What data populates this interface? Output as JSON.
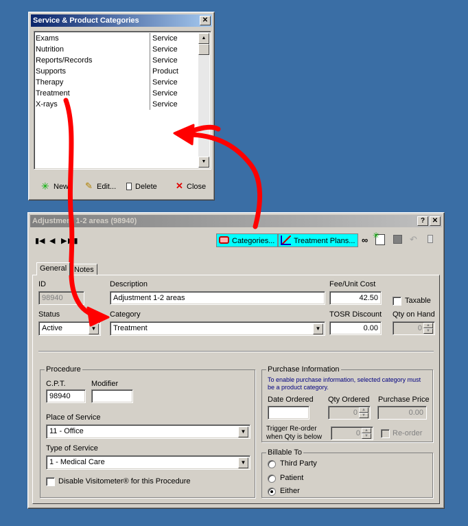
{
  "categories_window": {
    "title": "Service & Product Categories",
    "close_glyph": "✕",
    "rows": [
      {
        "name": "Exams",
        "type": "Service"
      },
      {
        "name": "Nutrition",
        "type": "Service"
      },
      {
        "name": "Reports/Records",
        "type": "Service"
      },
      {
        "name": "Supports",
        "type": "Product"
      },
      {
        "name": "Therapy",
        "type": "Service"
      },
      {
        "name": "Treatment",
        "type": "Service"
      },
      {
        "name": "X-rays",
        "type": "Service"
      }
    ],
    "buttons": {
      "new": "New",
      "edit": "Edit...",
      "delete": "Delete",
      "close": "Close"
    }
  },
  "main_window": {
    "title": "Adjustment 1-2 areas (98940)",
    "help_glyph": "?",
    "close_glyph": "✕",
    "toolbar": {
      "categories": "Categories...",
      "treatment_plans": "Treatment Plans..."
    },
    "tabs": [
      "General",
      "Notes"
    ],
    "id": {
      "label": "ID",
      "value": "98940"
    },
    "description": {
      "label": "Description",
      "value": "Adjustment 1-2 areas"
    },
    "fee": {
      "label": "Fee/Unit Cost",
      "value": "42.50"
    },
    "taxable": {
      "label": "Taxable",
      "checked": false
    },
    "status": {
      "label": "Status",
      "value": "Active"
    },
    "category": {
      "label": "Category",
      "value": "Treatment"
    },
    "tosr": {
      "label": "TOSR Discount",
      "value": "0.00"
    },
    "qty_on_hand": {
      "label": "Qty on Hand",
      "value": "0"
    },
    "procedure": {
      "title": "Procedure",
      "cpt_label": "C.P.T.",
      "cpt_value": "98940",
      "modifier_label": "Modifier",
      "modifier_value": "",
      "place_label": "Place of Service",
      "place_value": "11 - Office",
      "type_label": "Type of Service",
      "type_value": "1 - Medical Care",
      "visitometer_label": "Disable Visitometer® for this Procedure"
    },
    "purchase": {
      "title": "Purchase Information",
      "note": "To enable purchase information, selected category must be a product category.",
      "date_ordered_label": "Date Ordered",
      "qty_ordered_label": "Qty Ordered",
      "qty_ordered_value": "0",
      "price_label": "Purchase Price",
      "price_value": "0.00",
      "trigger_label_1": "Trigger Re-order",
      "trigger_label_2": "when Qty is below",
      "trigger_value": "0",
      "reorder_label": "Re-order"
    },
    "billable": {
      "title": "Billable To",
      "options": [
        "Third Party",
        "Patient",
        "Either"
      ],
      "selected": "Either"
    }
  },
  "colors": {
    "desktop": "#3a6ea5",
    "annotation": "#ff0000",
    "toolbar_highlight": "#00ffff"
  }
}
